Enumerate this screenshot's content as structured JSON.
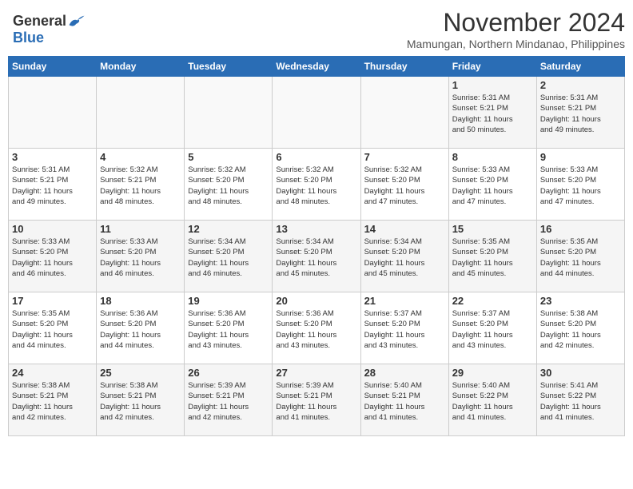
{
  "header": {
    "logo": {
      "general": "General",
      "blue": "Blue"
    },
    "month": "November 2024",
    "location": "Mamungan, Northern Mindanao, Philippines"
  },
  "weekdays": [
    "Sunday",
    "Monday",
    "Tuesday",
    "Wednesday",
    "Thursday",
    "Friday",
    "Saturday"
  ],
  "weeks": [
    [
      {
        "day": "",
        "info": ""
      },
      {
        "day": "",
        "info": ""
      },
      {
        "day": "",
        "info": ""
      },
      {
        "day": "",
        "info": ""
      },
      {
        "day": "",
        "info": ""
      },
      {
        "day": "1",
        "info": "Sunrise: 5:31 AM\nSunset: 5:21 PM\nDaylight: 11 hours\nand 50 minutes."
      },
      {
        "day": "2",
        "info": "Sunrise: 5:31 AM\nSunset: 5:21 PM\nDaylight: 11 hours\nand 49 minutes."
      }
    ],
    [
      {
        "day": "3",
        "info": "Sunrise: 5:31 AM\nSunset: 5:21 PM\nDaylight: 11 hours\nand 49 minutes."
      },
      {
        "day": "4",
        "info": "Sunrise: 5:32 AM\nSunset: 5:21 PM\nDaylight: 11 hours\nand 48 minutes."
      },
      {
        "day": "5",
        "info": "Sunrise: 5:32 AM\nSunset: 5:20 PM\nDaylight: 11 hours\nand 48 minutes."
      },
      {
        "day": "6",
        "info": "Sunrise: 5:32 AM\nSunset: 5:20 PM\nDaylight: 11 hours\nand 48 minutes."
      },
      {
        "day": "7",
        "info": "Sunrise: 5:32 AM\nSunset: 5:20 PM\nDaylight: 11 hours\nand 47 minutes."
      },
      {
        "day": "8",
        "info": "Sunrise: 5:33 AM\nSunset: 5:20 PM\nDaylight: 11 hours\nand 47 minutes."
      },
      {
        "day": "9",
        "info": "Sunrise: 5:33 AM\nSunset: 5:20 PM\nDaylight: 11 hours\nand 47 minutes."
      }
    ],
    [
      {
        "day": "10",
        "info": "Sunrise: 5:33 AM\nSunset: 5:20 PM\nDaylight: 11 hours\nand 46 minutes."
      },
      {
        "day": "11",
        "info": "Sunrise: 5:33 AM\nSunset: 5:20 PM\nDaylight: 11 hours\nand 46 minutes."
      },
      {
        "day": "12",
        "info": "Sunrise: 5:34 AM\nSunset: 5:20 PM\nDaylight: 11 hours\nand 46 minutes."
      },
      {
        "day": "13",
        "info": "Sunrise: 5:34 AM\nSunset: 5:20 PM\nDaylight: 11 hours\nand 45 minutes."
      },
      {
        "day": "14",
        "info": "Sunrise: 5:34 AM\nSunset: 5:20 PM\nDaylight: 11 hours\nand 45 minutes."
      },
      {
        "day": "15",
        "info": "Sunrise: 5:35 AM\nSunset: 5:20 PM\nDaylight: 11 hours\nand 45 minutes."
      },
      {
        "day": "16",
        "info": "Sunrise: 5:35 AM\nSunset: 5:20 PM\nDaylight: 11 hours\nand 44 minutes."
      }
    ],
    [
      {
        "day": "17",
        "info": "Sunrise: 5:35 AM\nSunset: 5:20 PM\nDaylight: 11 hours\nand 44 minutes."
      },
      {
        "day": "18",
        "info": "Sunrise: 5:36 AM\nSunset: 5:20 PM\nDaylight: 11 hours\nand 44 minutes."
      },
      {
        "day": "19",
        "info": "Sunrise: 5:36 AM\nSunset: 5:20 PM\nDaylight: 11 hours\nand 43 minutes."
      },
      {
        "day": "20",
        "info": "Sunrise: 5:36 AM\nSunset: 5:20 PM\nDaylight: 11 hours\nand 43 minutes."
      },
      {
        "day": "21",
        "info": "Sunrise: 5:37 AM\nSunset: 5:20 PM\nDaylight: 11 hours\nand 43 minutes."
      },
      {
        "day": "22",
        "info": "Sunrise: 5:37 AM\nSunset: 5:20 PM\nDaylight: 11 hours\nand 43 minutes."
      },
      {
        "day": "23",
        "info": "Sunrise: 5:38 AM\nSunset: 5:20 PM\nDaylight: 11 hours\nand 42 minutes."
      }
    ],
    [
      {
        "day": "24",
        "info": "Sunrise: 5:38 AM\nSunset: 5:21 PM\nDaylight: 11 hours\nand 42 minutes."
      },
      {
        "day": "25",
        "info": "Sunrise: 5:38 AM\nSunset: 5:21 PM\nDaylight: 11 hours\nand 42 minutes."
      },
      {
        "day": "26",
        "info": "Sunrise: 5:39 AM\nSunset: 5:21 PM\nDaylight: 11 hours\nand 42 minutes."
      },
      {
        "day": "27",
        "info": "Sunrise: 5:39 AM\nSunset: 5:21 PM\nDaylight: 11 hours\nand 41 minutes."
      },
      {
        "day": "28",
        "info": "Sunrise: 5:40 AM\nSunset: 5:21 PM\nDaylight: 11 hours\nand 41 minutes."
      },
      {
        "day": "29",
        "info": "Sunrise: 5:40 AM\nSunset: 5:22 PM\nDaylight: 11 hours\nand 41 minutes."
      },
      {
        "day": "30",
        "info": "Sunrise: 5:41 AM\nSunset: 5:22 PM\nDaylight: 11 hours\nand 41 minutes."
      }
    ]
  ]
}
